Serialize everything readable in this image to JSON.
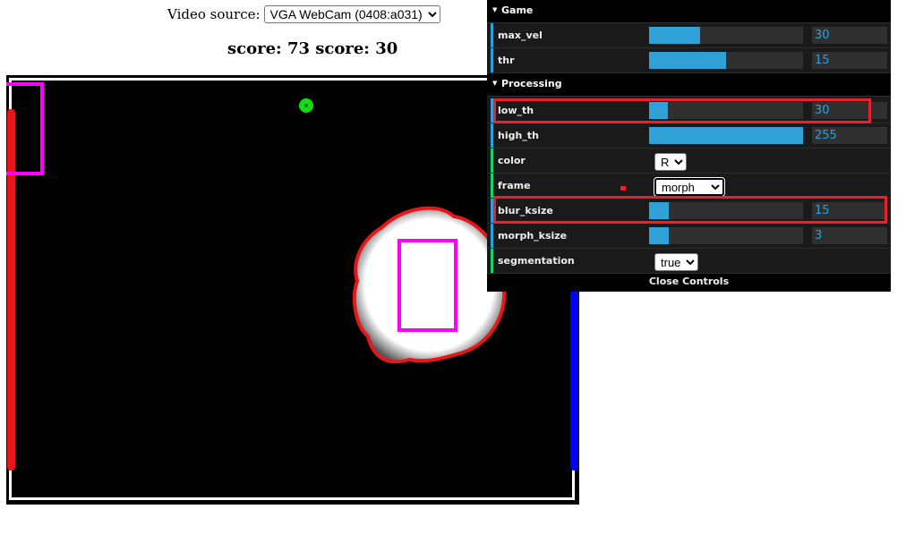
{
  "video_source": {
    "label": "Video source:",
    "selected": "VGA WebCam (0408:a031)"
  },
  "score_text": "score: 73 score: 30",
  "game": {
    "paddle_left_color": "#e51717",
    "paddle_right_color": "#0000ff",
    "ball_color": "#11dd11",
    "detection_box_color": "#ff00ff",
    "blob_outline_color": "#e51717"
  },
  "controls": {
    "folders": [
      {
        "title": "Game",
        "items": [
          {
            "name": "max_vel",
            "type": "slider",
            "value": "30",
            "fraction": 0.33
          },
          {
            "name": "thr",
            "type": "slider",
            "value": "15",
            "fraction": 0.5
          }
        ]
      },
      {
        "title": "Processing",
        "items": [
          {
            "name": "low_th",
            "type": "slider",
            "value": "30",
            "fraction": 0.12
          },
          {
            "name": "high_th",
            "type": "slider",
            "value": "255",
            "fraction": 1.0
          },
          {
            "name": "color",
            "type": "select",
            "value": "R"
          },
          {
            "name": "frame",
            "type": "select",
            "value": "morph"
          },
          {
            "name": "blur_ksize",
            "type": "slider",
            "value": "15",
            "fraction": 0.13
          },
          {
            "name": "morph_ksize",
            "type": "slider",
            "value": "3",
            "fraction": 0.13
          },
          {
            "name": "segmentation",
            "type": "select",
            "value": "true"
          }
        ]
      }
    ],
    "close_label": "Close Controls",
    "slider_color": "#2fa1d6",
    "number_color": "#2fa1d6",
    "highlight_color": "#e8222a"
  }
}
